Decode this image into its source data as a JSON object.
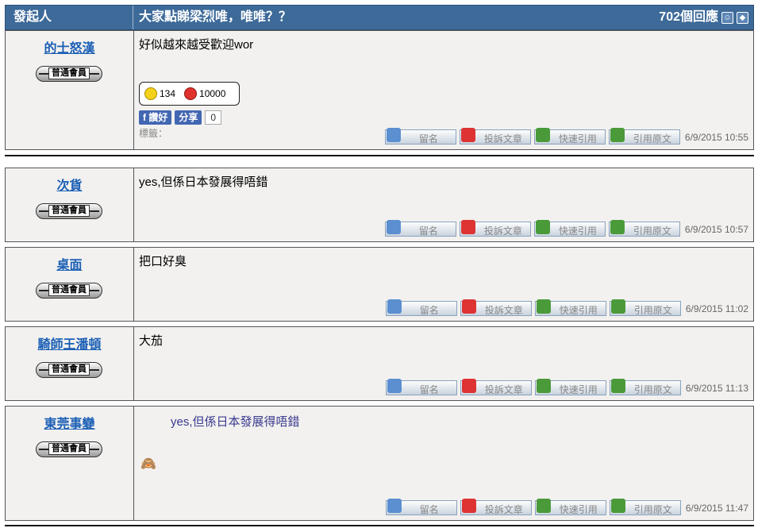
{
  "header": {
    "author_col": "發起人",
    "title": "大家點睇梁烈唯，唯唯？？",
    "reply_count": "702個回應"
  },
  "rating": {
    "up": "134",
    "down": "10000"
  },
  "fb": {
    "like": "讚好",
    "share": "分享",
    "count": "0"
  },
  "tags_label": "標籤：",
  "buttons": {
    "leave_name": "留名",
    "report": "投訴文章",
    "quick_quote": "快速引用",
    "quote": "引用原文"
  },
  "badge_label": "普通會員",
  "posts": [
    {
      "author": "的士怒漢",
      "content": "好似越來越受歡迎wor",
      "time": "6/9/2015 10:55"
    },
    {
      "author": "次貨",
      "content": "yes,但係日本發展得唔錯",
      "time": "6/9/2015 10:57"
    },
    {
      "author": "桌面",
      "content": "把口好臭",
      "time": "6/9/2015 11:02"
    },
    {
      "author": "騎師王潘頓",
      "content": "大茄",
      "time": "6/9/2015 11:13"
    },
    {
      "author": "東莞事變",
      "quote": "yes,但係日本發展得唔錯",
      "content": "",
      "time": "6/9/2015 11:47"
    }
  ],
  "colors": {
    "header_bg": "#3d6a99",
    "author_link": "#1b5fb5",
    "row_bg": "#f2f1ef"
  },
  "icons": {
    "users": "users-icon",
    "tag": "tag-icon",
    "emoji": "shy-face-emoji"
  }
}
